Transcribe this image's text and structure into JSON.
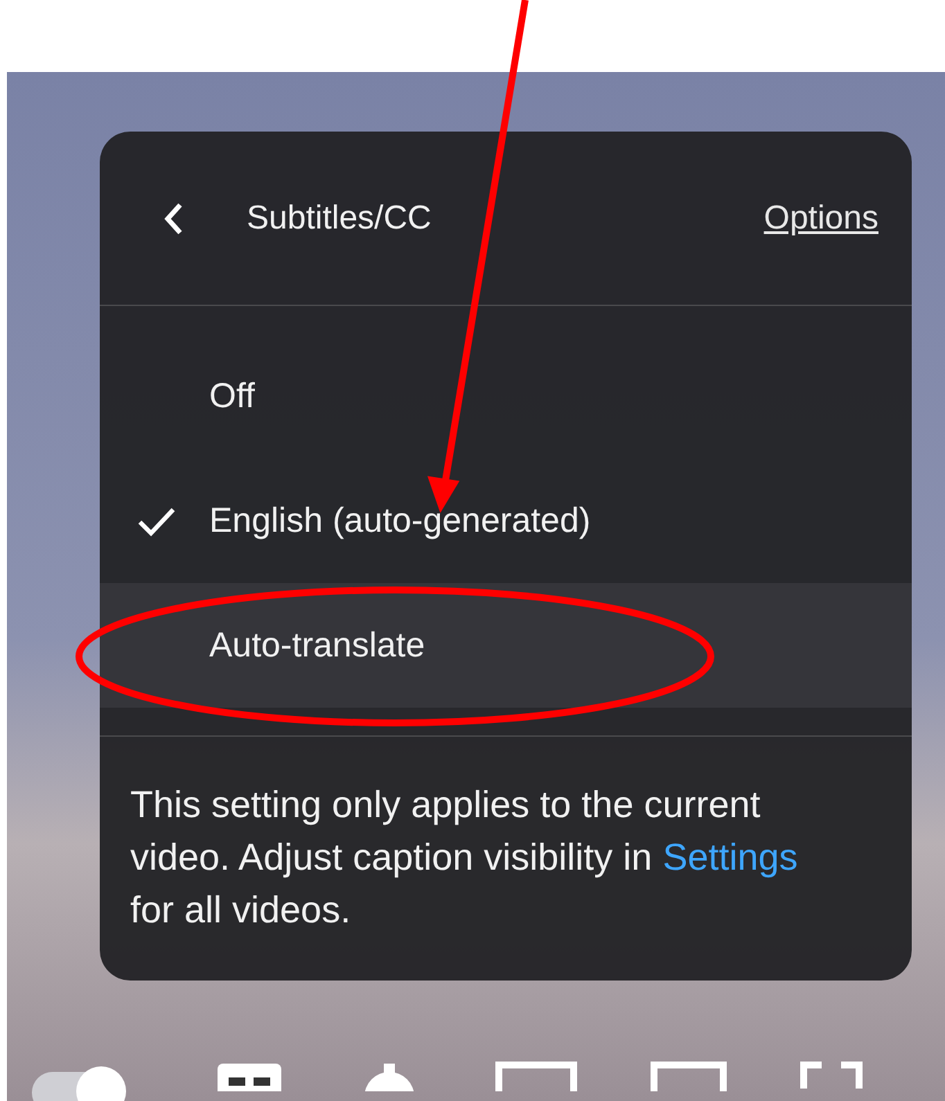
{
  "menu": {
    "title": "Subtitles/CC",
    "options_link": "Options",
    "items": [
      {
        "label": "Off",
        "selected": false,
        "highlighted": false
      },
      {
        "label": "English (auto-generated)",
        "selected": true,
        "highlighted": false
      },
      {
        "label": "Auto-translate",
        "selected": false,
        "highlighted": true
      }
    ],
    "note": {
      "text_before": "This setting only applies to the current video. Adjust caption visibility in",
      "link": "Settings",
      "text_after": "for all videos."
    }
  }
}
